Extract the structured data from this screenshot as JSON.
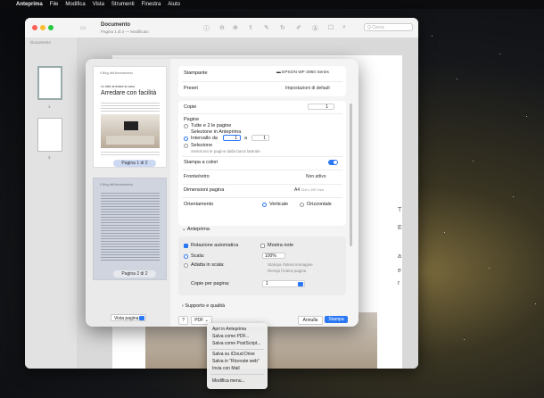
{
  "menubar": {
    "app": "Anteprima",
    "items": [
      "File",
      "Modifica",
      "Vista",
      "Strumenti",
      "Finestra",
      "Aiuto"
    ]
  },
  "window": {
    "title": "Documento",
    "subtitle": "Pagina 1 di 2 — Modificato",
    "search_placeholder": "Q Cerca",
    "sidebar_title": "Documento",
    "thumb_nums": [
      "1",
      "2"
    ]
  },
  "preview": {
    "page1": {
      "header": "Il Blog dell'Arredamento",
      "kicker": "Le idee arredare la casa",
      "title": "Arredare con facilità",
      "badge": "Pagina 1 di 2"
    },
    "page2": {
      "header": "Il Blog dell'Arredamento",
      "badge": "Pagina 2 di 2"
    },
    "vista_label": "Vista pagina"
  },
  "settings": {
    "printer_label": "Stampante",
    "printer_value": "EPSON WF-2950 Series",
    "preset_label": "Preset",
    "preset_value": "Impostazioni di default",
    "copies_label": "Copie",
    "copies_value": "1",
    "pages_label": "Pagine",
    "pages_options": [
      "Tutte e 2 le pagine",
      "Selezione in Anteprima",
      "Intervallo da",
      "Selezione"
    ],
    "range_from": "1",
    "range_to_label": "a",
    "range_to": "1",
    "selection_hint": "Seleziona le pagine dalla barra laterale",
    "color_label": "Stampa a colori",
    "duplex_label": "Fronte/retro",
    "duplex_value": "Non attivo",
    "size_label": "Dimensioni pagina",
    "size_value": "A4",
    "size_dim": "210 x 297 mm",
    "orient_label": "Orientamento",
    "orient_vertical": "Verticale",
    "orient_horizontal": "Orizzontale",
    "anteprima_section": "Anteprima",
    "auto_rotate": "Rotazione automatica",
    "show_notes": "Mostra note",
    "scale_label": "Scala:",
    "scale_value": "100%",
    "fit_label": "Adatta in scala:",
    "fit_opt1": "Stampa l'intera immagine",
    "fit_opt2": "Riempi l'intera pagina",
    "per_page_label": "Copie per pagina:",
    "per_page_value": "1",
    "support_section": "Supporto e qualità"
  },
  "bottom": {
    "help": "?",
    "pdf": "PDF",
    "cancel": "Annulla",
    "print": "Stampa"
  },
  "pdf_menu": [
    "Apri in Anteprima",
    "Salva come PDF...",
    "Salva come PostScript...",
    "Salva su iCloud Drive",
    "Salva in \"Ricevute web\"",
    "Invia con Mail",
    "Modifica menu..."
  ],
  "background_text": [
    "T",
    "E",
    "a",
    "e",
    "r"
  ],
  "colors": {
    "accent": "#2b78f5",
    "traffic_red": "#fe5f57",
    "traffic_yellow": "#febc2e",
    "traffic_green": "#28c840"
  }
}
